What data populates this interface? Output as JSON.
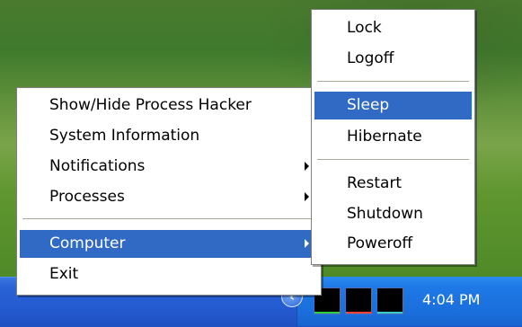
{
  "tray_menu": {
    "items": [
      {
        "label": "Show/Hide Process Hacker",
        "has_submenu": false
      },
      {
        "label": "System Information",
        "has_submenu": false
      },
      {
        "label": "Notifications",
        "has_submenu": true
      },
      {
        "label": "Processes",
        "has_submenu": true
      },
      {
        "label": "Computer",
        "has_submenu": true,
        "highlighted": true
      },
      {
        "label": "Exit",
        "has_submenu": false
      }
    ]
  },
  "computer_submenu": {
    "items": [
      {
        "label": "Lock"
      },
      {
        "label": "Logoff"
      },
      {
        "label": "Sleep",
        "highlighted": true
      },
      {
        "label": "Hibernate"
      },
      {
        "label": "Restart"
      },
      {
        "label": "Shutdown"
      },
      {
        "label": "Poweroff"
      }
    ]
  },
  "taskbar": {
    "clock": "4:04 PM",
    "tray_expand_icon": "chevron-left-icon",
    "tray_graph_icons": [
      "cpu-graph-icon",
      "io-graph-icon",
      "memory-graph-icon"
    ]
  },
  "colors": {
    "highlight": "#316ac5",
    "taskbar": "#245bd0",
    "tray": "#1e79e6"
  }
}
